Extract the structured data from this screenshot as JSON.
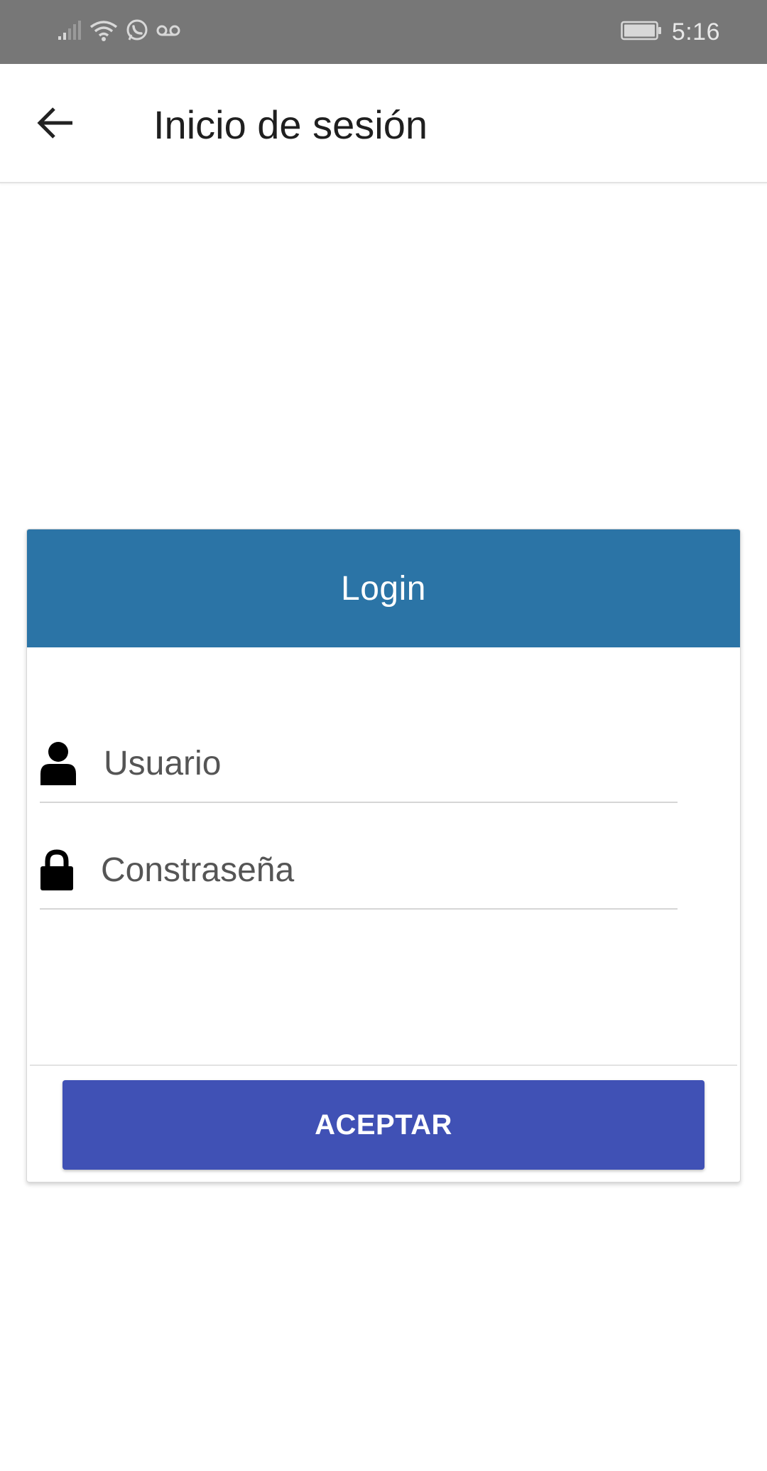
{
  "status_bar": {
    "time": "5:16",
    "icons": [
      "signal-icon",
      "wifi-icon",
      "whatsapp-icon",
      "voicemail-icon",
      "battery-icon"
    ]
  },
  "app_bar": {
    "back_icon": "arrow-back-icon",
    "title": "Inicio de sesión"
  },
  "card": {
    "header_title": "Login",
    "header_color": "#2b74a6",
    "username": {
      "icon": "user-icon",
      "placeholder": "Usuario",
      "value": ""
    },
    "password": {
      "icon": "lock-icon",
      "placeholder": "Constraseña",
      "value": ""
    },
    "submit_label": "ACEPTAR",
    "submit_color": "#4051b5"
  }
}
